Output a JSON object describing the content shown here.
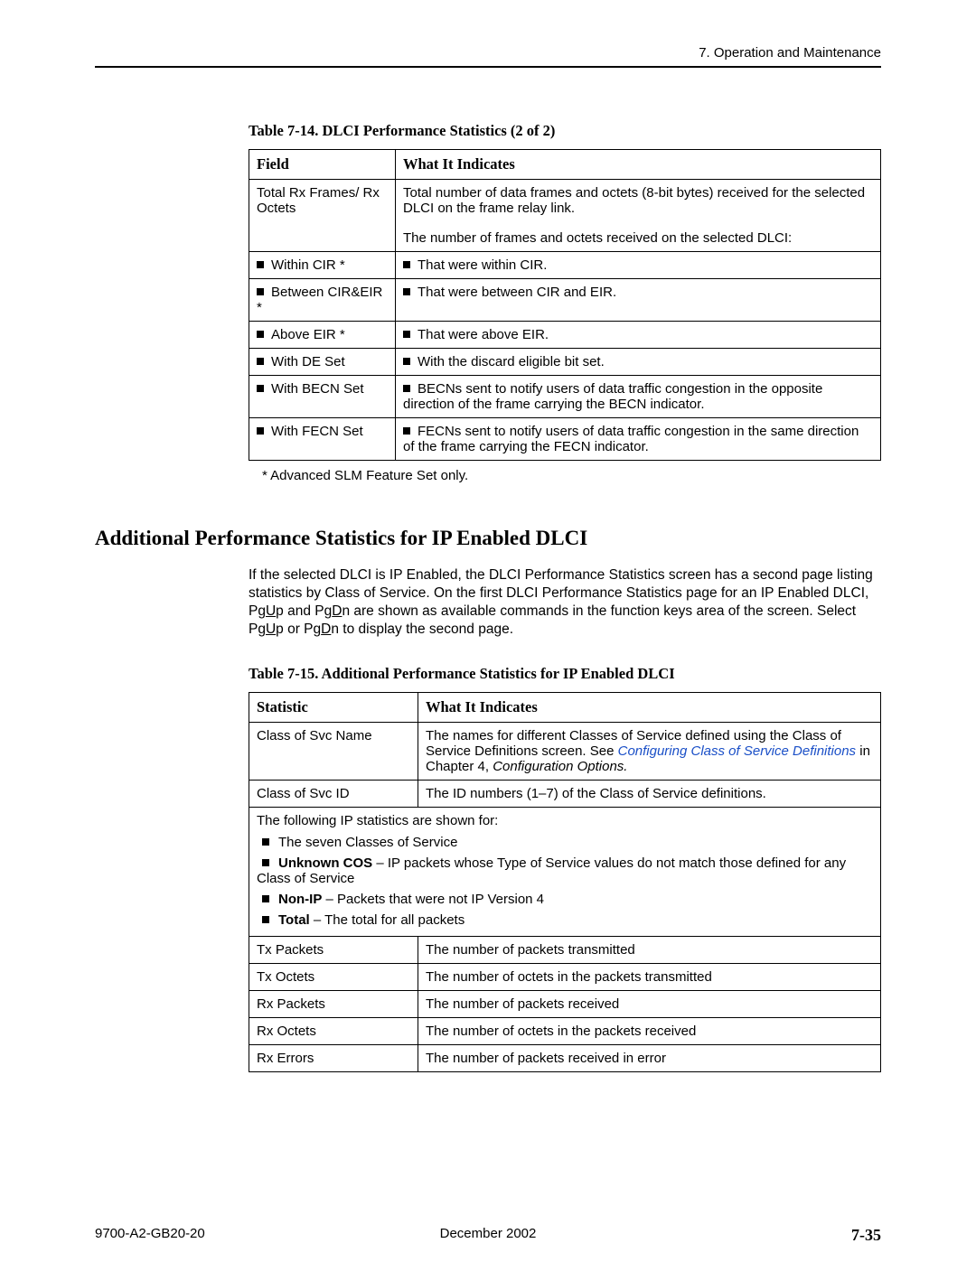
{
  "header": {
    "chapter": "7. Operation and Maintenance"
  },
  "table14": {
    "caption": "Table 7-14.  DLCI Performance Statistics (2 of 2)",
    "head_field": "Field",
    "head_what": "What It Indicates",
    "row1_field": "Total Rx Frames/ Rx Octets",
    "row1_what": "Total number of data frames and octets (8-bit bytes) received for the selected DLCI on the frame relay link.",
    "row_label_only": "The number of frames and octets received on the selected DLCI:",
    "b1_f": "Within CIR *",
    "b1_w": "That were within CIR.",
    "b2_f": "Between CIR&EIR *",
    "b2_w": "That were between CIR and EIR.",
    "b3_f": "Above EIR *",
    "b3_w": "That were above EIR.",
    "b4_f": "With DE Set",
    "b4_w": "With the discard eligible bit set.",
    "b5_f": "With BECN Set",
    "b5_w": "BECNs sent to notify users of data traffic congestion in the opposite direction of the frame carrying the BECN indicator.",
    "b6_f": "With FECN Set",
    "b6_w": "FECNs sent to notify users of data traffic congestion in the same direction of the frame carrying the FECN indicator.",
    "footnote": "* Advanced SLM Feature Set only."
  },
  "section_heading": "Additional Performance Statistics for IP Enabled DLCI",
  "para": {
    "t1": "If the selected DLCI is IP Enabled, the DLCI Performance Statistics screen has a second page listing statistics by Class of Service. On the first DLCI Performance Statistics page for an IP Enabled DLCI, Pg",
    "u1": "U",
    "t2": "p and Pg",
    "u2": "D",
    "t3": "n are shown as available commands in the function keys area of the screen. Select Pg",
    "u3": "U",
    "t4": "p or Pg",
    "u4": "D",
    "t5": "n to display the second page."
  },
  "table15": {
    "caption": "Table 7-15.  Additional Performance Statistics for IP Enabled DLCI",
    "head_stat": "Statistic",
    "head_what": "What It Indicates",
    "r1_s": "Class of Svc Name",
    "r1_w1": "The names for different Classes of Service defined using the Class of Service Definitions screen. See ",
    "r1_link": "Configuring Class of Service Definitions",
    "r1_w2": " in Chapter 4, ",
    "r1_ital": "Configuration Options.",
    "r2_s": "Class of Svc ID",
    "r2_w": "The ID numbers (1–7) of the Class of Service definitions.",
    "span_intro": "The following IP statistics are shown for:",
    "li1": "The seven Classes of Service",
    "li2a": "Unknown COS",
    "li2b": " – IP packets whose Type of Service values do not match those defined for any Class of Service",
    "li3a": "Non-IP",
    "li3b": " – Packets that were not IP Version 4",
    "li4a": "Total",
    "li4b": " – The total for all packets",
    "r3_s": "Tx Packets",
    "r3_w": "The number of packets transmitted",
    "r4_s": "Tx Octets",
    "r4_w": "The number of octets in the packets transmitted",
    "r5_s": "Rx Packets",
    "r5_w": "The number of packets received",
    "r6_s": "Rx Octets",
    "r6_w": "The number of octets in the packets received",
    "r7_s": "Rx Errors",
    "r7_w": "The number of packets received in error"
  },
  "footer": {
    "left": "9700-A2-GB20-20",
    "center": "December 2002",
    "right": "7-35"
  }
}
